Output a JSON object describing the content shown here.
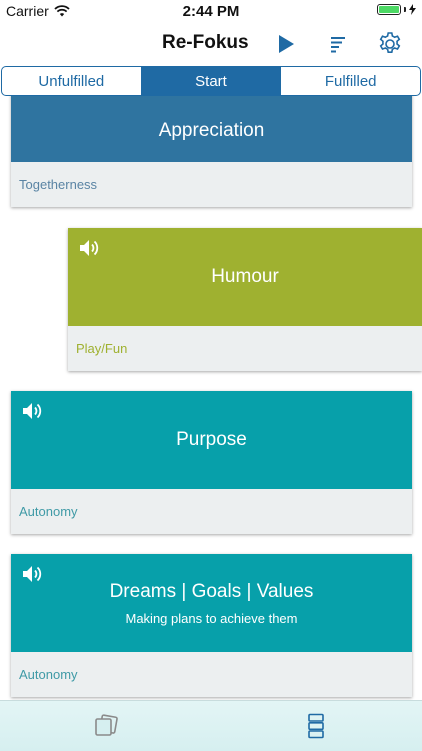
{
  "status_bar": {
    "carrier": "Carrier",
    "time": "2:44 PM",
    "battery_level": 1.0,
    "icons": [
      "wifi-icon",
      "battery-icon",
      "charging-bolt-icon"
    ]
  },
  "nav": {
    "title": "Re-Fokus",
    "buttons": [
      "play-icon",
      "sort-icon",
      "gear-icon"
    ],
    "accent_color": "#1f6aa4"
  },
  "segments": {
    "items": [
      "Unfulfilled",
      "Start",
      "Fulfilled"
    ],
    "selected": "Start"
  },
  "cards": [
    {
      "title": "Appreciation",
      "subtitle": "",
      "category": "Togetherness",
      "color": "#2f74a0",
      "foot_color": "#5a84a4",
      "has_audio": false
    },
    {
      "title": "Humour",
      "subtitle": "",
      "category": "Play/Fun",
      "color": "#9fb130",
      "foot_color": "#9fb130",
      "has_audio": true
    },
    {
      "title": "Purpose",
      "subtitle": "",
      "category": "Autonomy",
      "color": "#07a0aa",
      "foot_color": "#3f9aa6",
      "has_audio": true
    },
    {
      "title": "Dreams | Goals | Values",
      "subtitle": "Making plans to achieve them",
      "category": "Autonomy",
      "color": "#07a0aa",
      "foot_color": "#3f9aa6",
      "has_audio": true
    }
  ],
  "tab_bar": {
    "tabs": [
      "cards-icon",
      "list-icon"
    ],
    "selected": "list-icon",
    "active_color": "#1f6aa4",
    "inactive_color": "#8a8a8a"
  }
}
